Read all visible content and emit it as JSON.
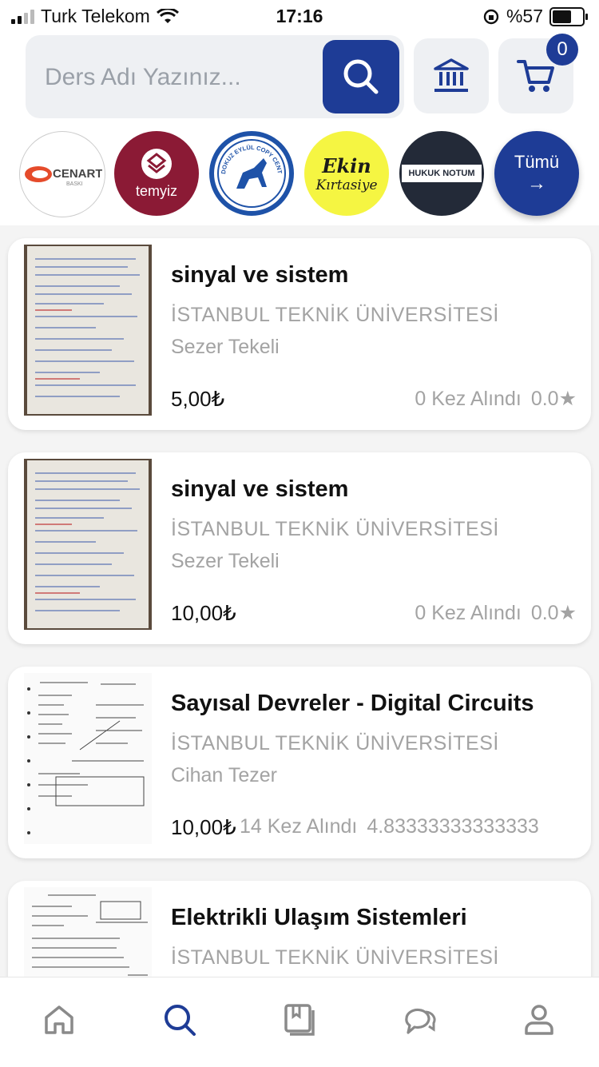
{
  "status_bar": {
    "carrier": "Turk Telekom",
    "time": "17:16",
    "battery": "%57",
    "battery_level": 0.57
  },
  "search": {
    "placeholder": "Ders Adı Yazınız..."
  },
  "header": {
    "cart_count": "0",
    "icons": [
      "search-icon",
      "bank-icon",
      "cart-icon"
    ]
  },
  "stores": [
    {
      "name": "CENART",
      "sub": "BASKI"
    },
    {
      "name": "temyiz"
    },
    {
      "name": "DOKUZ EYLÜL COPY CENTER"
    },
    {
      "name": "Ekin",
      "sub": "Kırtasiye"
    },
    {
      "name": "HUKUK NOTUM"
    }
  ],
  "all_button": {
    "label": "Tümü",
    "arrow": "→"
  },
  "items": [
    {
      "title": "sinyal ve sistem",
      "university": "İSTANBUL TEKNİK ÜNİVERSİTESİ",
      "teacher": "Sezer Tekeli",
      "price": "5,00₺",
      "sold": "0 Kez Alındı",
      "rating": "0.0"
    },
    {
      "title": "sinyal ve sistem",
      "university": "İSTANBUL TEKNİK ÜNİVERSİTESİ",
      "teacher": "Sezer Tekeli",
      "price": "10,00₺",
      "sold": "0 Kez Alındı",
      "rating": "0.0"
    },
    {
      "title": "Sayısal Devreler - Digital Circuits",
      "university": "İSTANBUL TEKNİK ÜNİVERSİTESİ",
      "teacher": "Cihan Tezer",
      "price": "10,00₺",
      "sold": "14 Kez Alındı",
      "rating": "4.83333333333333"
    },
    {
      "title": "Elektrikli Ulaşım Sistemleri",
      "university": "İSTANBUL TEKNİK ÜNİVERSİTESİ"
    }
  ],
  "tabbar": {
    "active": "search",
    "tabs": [
      "home-icon",
      "search-icon",
      "notes-icon",
      "chat-icon",
      "profile-icon"
    ]
  },
  "colors": {
    "primary": "#1e3c96",
    "muted": "#a3a3a3",
    "temyiz": "#8b1a35",
    "ekin": "#f5f542",
    "hukuk": "#232a38"
  }
}
